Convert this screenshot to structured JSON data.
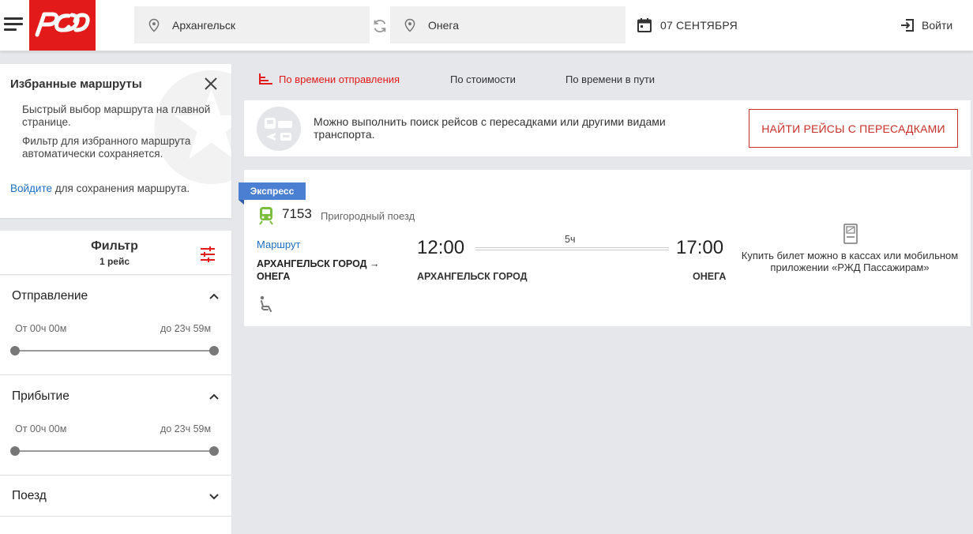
{
  "header": {
    "from": "Архангельск",
    "to": "Онега",
    "date": "07 СЕНТЯБРЯ",
    "login_label": "Войти",
    "brand_color": "#e21a1a"
  },
  "favorites": {
    "title": "Избранные маршруты",
    "text1": "Быстрый выбор маршрута на главной странице.",
    "text2": "Фильтр для избранного маршрута автоматически сохраняется.",
    "login_link": "Войдите",
    "login_suffix": " для сохранения маршрута."
  },
  "filter": {
    "title": "Фильтр",
    "count": "1 рейс",
    "departure": {
      "title": "Отправление",
      "from": "От 00ч 00м",
      "to": "до 23ч 59м"
    },
    "arrival": {
      "title": "Прибытие",
      "from": "От 00ч 00м",
      "to": "до 23ч 59м"
    },
    "train": {
      "title": "Поезд"
    }
  },
  "sort": {
    "by_departure": "По времени отправления",
    "by_price": "По стоимости",
    "by_travel_time": "По времени в пути"
  },
  "banner": {
    "text": "Можно выполнить поиск рейсов с пересадками или другими видами транспорта.",
    "button": "НАЙТИ РЕЙСЫ С ПЕРЕСАДКАМИ"
  },
  "train": {
    "badge": "Экспресс",
    "number": "7153",
    "type": "Пригородный поезд",
    "route_label": "Маршрут",
    "route_names": "АРХАНГЕЛЬСК ГОРОД → ОНЕГА",
    "departure_time": "12:00",
    "arrival_time": "17:00",
    "duration": "5ч",
    "departure_station": "АРХАНГЕЛЬСК ГОРОД",
    "arrival_station": "ОНЕГА",
    "ticket_info": "Купить билет можно в кассах или мобильном приложении «РЖД Пассажирам»"
  }
}
